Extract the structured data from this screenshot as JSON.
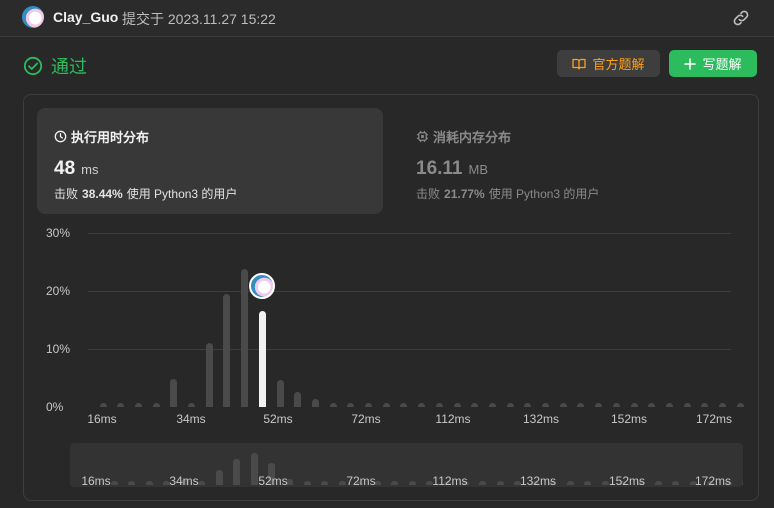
{
  "header": {
    "username": "Clay_Guo",
    "submitted_text": "提交于 2023.11.27 15:22",
    "avatar_icon": "user-avatar-icon",
    "link_icon": "link-icon"
  },
  "status": {
    "text": "通过",
    "icon": "check-circle-icon",
    "color": "#2cbb5d"
  },
  "actions": {
    "official_label": "官方题解",
    "official_icon": "book-icon",
    "write_label": "写题解",
    "write_icon": "plus-icon"
  },
  "runtime": {
    "title": "执行用时分布",
    "icon": "clock-icon",
    "value": "48",
    "unit": "ms",
    "beat_prefix": "击败",
    "beat_percent": "38.44%",
    "beat_suffix": "使用 Python3 的用户"
  },
  "memory": {
    "title": "消耗内存分布",
    "icon": "chip-icon",
    "value": "16.11",
    "unit": "MB",
    "beat_prefix": "击败",
    "beat_percent": "21.77%",
    "beat_suffix": "使用 Python3 的用户"
  },
  "chart_data": {
    "type": "bar",
    "ylim": [
      0,
      30
    ],
    "yticks": [
      "30%",
      "20%",
      "10%",
      "0%"
    ],
    "x_tick_labels": [
      "16ms",
      "34ms",
      "52ms",
      "72ms",
      "112ms",
      "132ms",
      "152ms",
      "172ms"
    ],
    "values": [
      0.7,
      0.7,
      0.7,
      0.7,
      4.8,
      0.7,
      11,
      19.5,
      23.8,
      16.5,
      4.6,
      2.6,
      1.3,
      0.7,
      0.7,
      0.7,
      0.7,
      0.7,
      0.7,
      0.7,
      0.7,
      0.7,
      0.7,
      0.7,
      0.7,
      0.7,
      0.7,
      0.7,
      0.7,
      0.7,
      0.7,
      0.7,
      0.7,
      0.7,
      0.7,
      0.7,
      0.7
    ],
    "highlight_index": 9,
    "highlight_color": "#f2f2f2",
    "bar_color": "#4a4a4a"
  },
  "mini_chart": {
    "x_tick_labels": [
      "16ms",
      "34ms",
      "52ms",
      "72ms",
      "112ms",
      "132ms",
      "152ms",
      "172ms"
    ]
  }
}
